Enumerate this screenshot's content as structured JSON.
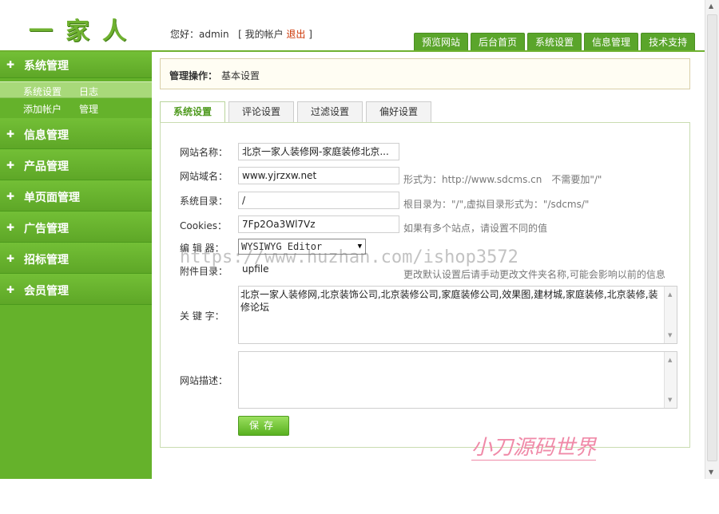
{
  "header": {
    "logo_chars": [
      "一",
      "家",
      "人"
    ],
    "greeting_prefix": "您好：admin",
    "bracket_open": "[",
    "account_link": "我的帐户",
    "logout_link": "退出",
    "bracket_close": "]"
  },
  "topnav": [
    "预览网站",
    "后台首页",
    "系统设置",
    "信息管理",
    "技术支持"
  ],
  "sidebar": {
    "groups": [
      {
        "label": "系统管理"
      },
      {
        "label": "信息管理"
      },
      {
        "label": "产品管理"
      },
      {
        "label": "单页面管理"
      },
      {
        "label": "广告管理"
      },
      {
        "label": "招标管理"
      },
      {
        "label": "会员管理"
      }
    ],
    "sub_items": [
      {
        "a": "系统设置",
        "b": "日志"
      },
      {
        "a": "添加帐户",
        "b": "管理"
      }
    ],
    "plus_icon": "✚"
  },
  "breadcrumb": {
    "label": "管理操作：",
    "value": "基本设置"
  },
  "tabs": [
    "系统设置",
    "评论设置",
    "过滤设置",
    "偏好设置"
  ],
  "form": {
    "site_name_label": "网站名称：",
    "site_name_value": "北京一家人装修网-家庭装修北京...",
    "domain_label": "网站域名：",
    "domain_value": "www.yjrzxw.net",
    "domain_hint": "形式为：http://www.sdcms.cn　不需要加\"/\"",
    "dir_label": "系统目录：",
    "dir_value": "/",
    "dir_hint": "根目录为：\"/\",虚拟目录形式为：\"/sdcms/\"",
    "cookies_label": "Cookies：",
    "cookies_value": "7Fp2Oa3Wl7Vz",
    "cookies_hint": "如果有多个站点，请设置不同的值",
    "editor_label": "编 辑 器：",
    "editor_value": "WYSIWYG Editor",
    "attach_label": "附件目录：",
    "attach_value": "upfile",
    "attach_hint": "更改默认设置后请手动更改文件夹名称,可能会影响以前的信息",
    "keywords_label": "关 键 字：",
    "keywords_value": "北京一家人装修网,北京装饰公司,北京装修公司,家庭装修公司,效果图,建材城,家庭装修,北京装修,装修论坛",
    "desc_label": "网站描述：",
    "desc_value": "",
    "save_label": "保存"
  },
  "watermarks": {
    "url": "https://www.huzhan.com/ishop3572",
    "brand": "小刀源码世界"
  },
  "colors": {
    "brand_green": "#65b22b",
    "logout": "#cc3300",
    "active_tab": "#4f9a1f"
  }
}
